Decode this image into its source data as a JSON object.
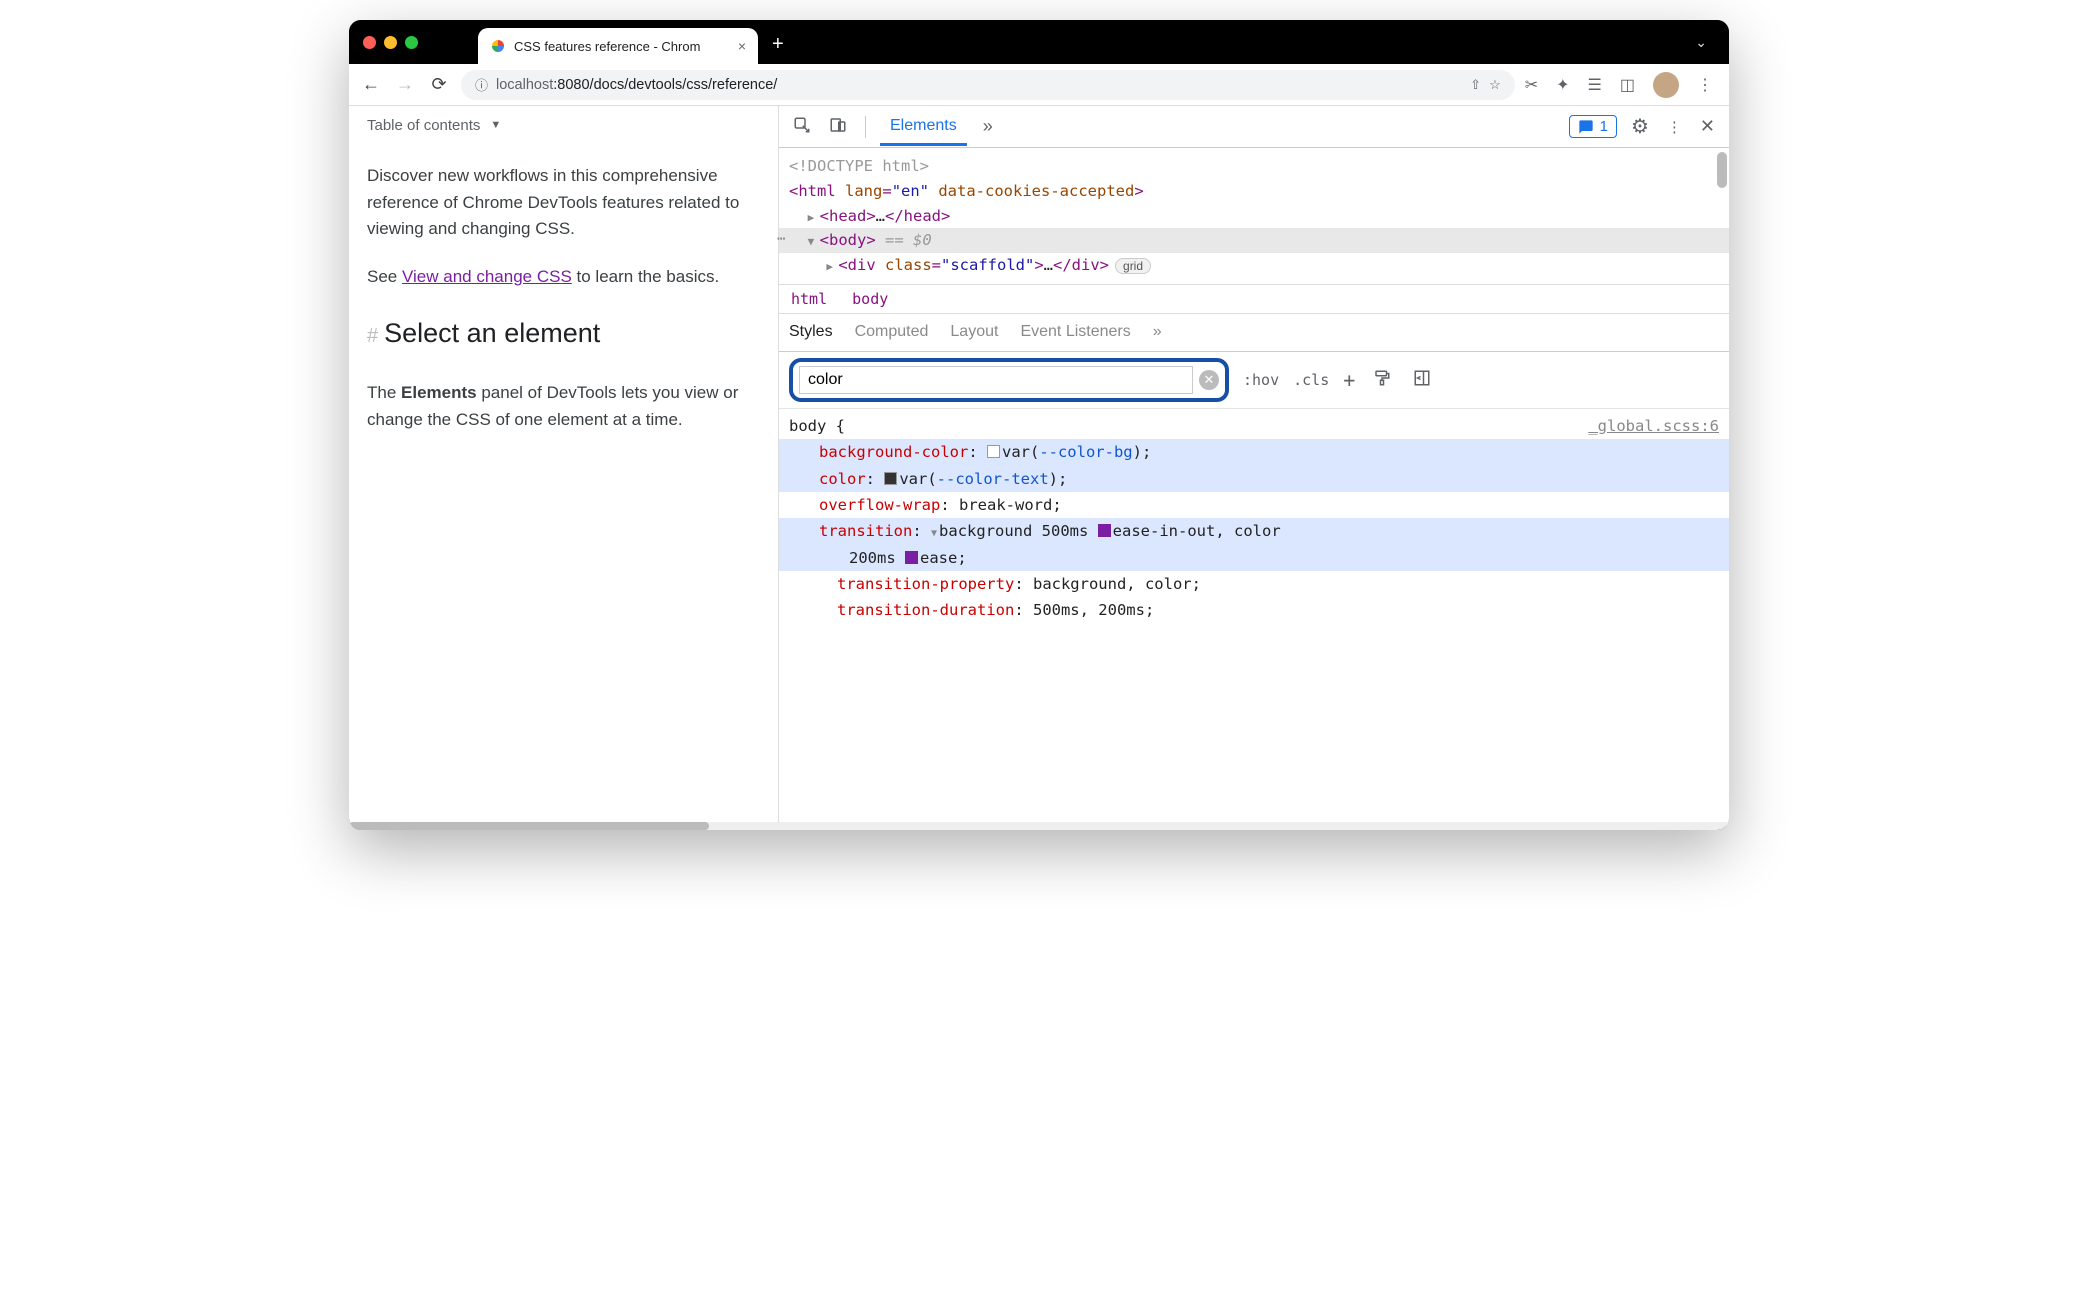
{
  "window": {
    "tab_title": "CSS features reference - Chrom",
    "url_info_icon": "ⓘ",
    "url_host": "localhost",
    "url_port": ":8080",
    "url_path": "/docs/devtools/css/reference/"
  },
  "page": {
    "toc_label": "Table of contents",
    "intro": "Discover new workflows in this comprehensive reference of Chrome DevTools features related to viewing and changing CSS.",
    "see_prefix": "See ",
    "see_link": "View and change CSS",
    "see_suffix": " to learn the basics.",
    "hash": "#",
    "h2": "Select an element",
    "elements_para_1": "The ",
    "elements_bold": "Elements",
    "elements_para_2": " panel of DevTools lets you view or change the CSS of one element at a time."
  },
  "devtools": {
    "tabs": {
      "elements": "Elements",
      "more": "»"
    },
    "issues_count": "1",
    "dom": {
      "doctype": "<!DOCTYPE html>",
      "html_open": "<html",
      "html_lang_attr": " lang",
      "html_lang_val": "\"en\"",
      "html_cookies_attr": " data-cookies-accepted",
      "html_close": ">",
      "head": "<head>",
      "head_ellipsis": "…",
      "head_close": "</head>",
      "body_open": "<body>",
      "body_eq": " == ",
      "body_dollar": "$0",
      "div_open": "<div",
      "div_class_attr": " class",
      "div_class_val": "\"scaffold\"",
      "div_close": ">",
      "div_ellipsis": "…",
      "div_end": "</div>",
      "grid_badge": "grid"
    },
    "breadcrumb": {
      "html": "html",
      "body": "body"
    },
    "subtabs": {
      "styles": "Styles",
      "computed": "Computed",
      "layout": "Layout",
      "listeners": "Event Listeners",
      "more": "»"
    },
    "filter_value": "color",
    "toolbar_btns": {
      "hov": ":hov",
      "cls": ".cls",
      "plus": "+"
    },
    "rule": {
      "selector": "body {",
      "source": "_global.scss:6",
      "bg_prop": "background-color",
      "bg_var": "--color-bg",
      "color_prop": "color",
      "color_var": "--color-text",
      "overflow_prop": "overflow-wrap",
      "overflow_val": "break-word",
      "transition_prop": "transition",
      "transition_val1": "background 500ms ",
      "transition_ease1": "ease-in-out",
      "transition_comma": ", color",
      "transition_line2": "200ms ",
      "transition_ease2": "ease",
      "tprop_prop": "transition-property",
      "tprop_val": "background, color",
      "tdur_prop": "transition-duration",
      "tdur_val": "500ms, 200ms"
    }
  }
}
